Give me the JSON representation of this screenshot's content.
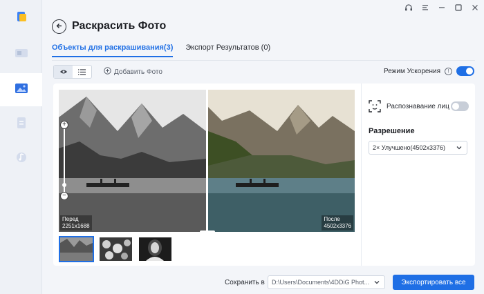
{
  "app": {
    "title": "Раскрасить Фото",
    "accent_color": "#1f6fe5"
  },
  "rail": {
    "items": [
      {
        "icon": "app-logo-icon"
      },
      {
        "icon": "video-icon"
      },
      {
        "icon": "photo-icon",
        "active": true
      },
      {
        "icon": "document-icon"
      },
      {
        "icon": "music-icon"
      }
    ]
  },
  "window_controls": [
    "headset-icon",
    "menu-icon",
    "minimize-icon",
    "maximize-icon",
    "close-icon"
  ],
  "tabs": [
    {
      "label": "Объекты для раскрашивания(3)",
      "active": true
    },
    {
      "label": "Экспорт Результатов (0)",
      "active": false
    }
  ],
  "toolbar": {
    "add_photo_label": "Добавить Фото",
    "accel_label": "Режим Ускорения",
    "accel_enabled": true
  },
  "viewer": {
    "before_label": "Перед",
    "before_size": "2251x1688",
    "after_label": "После",
    "after_size": "4502x3376"
  },
  "settings": {
    "face_label": "Распознавание лиц",
    "face_enabled": false,
    "resolution_title": "Разрешение",
    "resolution_value": "2× Улучшено(4502x3376)"
  },
  "footer": {
    "save_label": "Сохранить в",
    "save_path": "D:\\Users\\Documents\\4DDiG Phot...",
    "export_label": "Экспортировать все"
  }
}
